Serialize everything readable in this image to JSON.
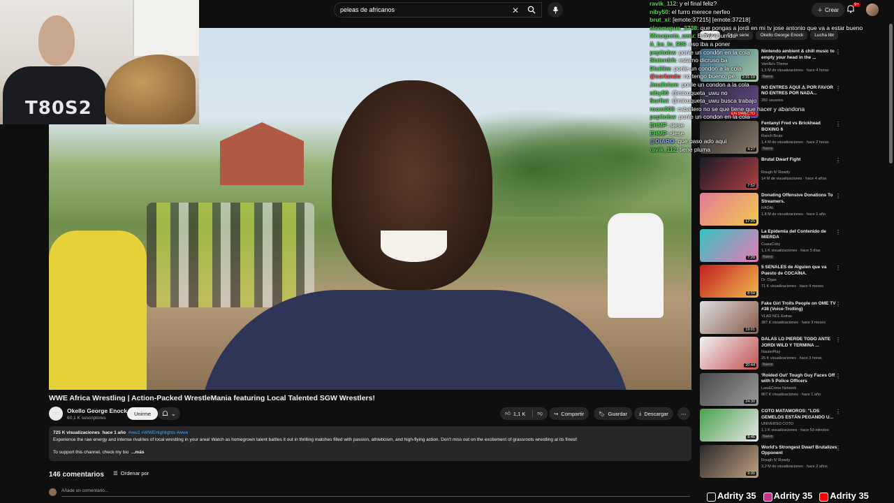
{
  "search": {
    "value": "peleas de africanos"
  },
  "header": {
    "create_label": "Crear",
    "notif_count": "9+"
  },
  "webcam": {
    "shirt_text": "T80S2"
  },
  "chat": [
    {
      "user": "ravik_112",
      "text": "y el final feliz?",
      "color": "green"
    },
    {
      "user": "niby50",
      "text": "el furro merece nerfeo",
      "color": "green"
    },
    {
      "user": "brut_xi",
      "text": "[emote:37215] [emote:37218]",
      "color": "green"
    },
    {
      "user": "elcomepus_3738",
      "text": "que pongas a jordi en mi tv jose antonio que va a estar bueno",
      "color": "green"
    },
    {
      "user": "Mixuqueta_uwu",
      "text": "Estoy aburrida",
      "color": "green"
    },
    {
      "user": "A_be_lo_909",
      "text": "eso iba a poner",
      "color": "green"
    },
    {
      "user": "pepitobw",
      "text": "ponle un condón en la cola",
      "color": "green"
    },
    {
      "user": "Slaterdrh",
      "text": "estamo dicruso ba",
      "color": "green"
    },
    {
      "user": "Dlaiiiim",
      "text": "ponle un condon a la cola",
      "color": "green"
    },
    {
      "user": "@sorlando",
      "text": "no tengo bueno, pe...",
      "color": "red"
    },
    {
      "user": "Jmallelam",
      "text": "ponle un condon a la cola",
      "color": "green"
    },
    {
      "user": "niby50",
      "text": "@mixuqueta_uwu no",
      "color": "green"
    },
    {
      "user": "Surfist",
      "text": "@mixuqueta_uwu busca trabajo",
      "color": "green"
    },
    {
      "user": "room008",
      "text": "caballero no se que tiene que hacer y abandona",
      "color": "green"
    },
    {
      "user": "pepitobw",
      "text": "ponle un condon en la cola",
      "color": "green"
    },
    {
      "user": "EHMP",
      "text": "siese",
      "color": "green"
    },
    {
      "user": "EHMP",
      "text": "siese",
      "color": "green"
    },
    {
      "user": "@DIARO",
      "text": "que paso ado aqui",
      "color": "blue"
    },
    {
      "user": "ravik_112",
      "text": "tiene pluma",
      "color": "green"
    }
  ],
  "video": {
    "title": "WWE Africa Wrestling | Action-Packed WrestleMania featuring Local Talented SGW Wrestlers!",
    "channel": "Okello George Enock",
    "subs": "60,1 K suscriptores",
    "join_label": "Unirme",
    "likes": "1,1 K",
    "share_label": "Compartir",
    "save_label": "Guardar",
    "download_label": "Descargar",
    "views": "725 K visualizaciones",
    "age": "hace 1 año",
    "tags": "#ww2 #WWEHighlights #wwe",
    "description": "Experience the raw energy and intense rivalries of local wrestling in your area! Watch as homegrown talent battles it out in thrilling matches filled with passion, athleticism, and high-flying action. Don't miss out on the excitement of grassroots wrestling at its finest!",
    "support": "To support this channel, check my bio",
    "more": "...más"
  },
  "comments": {
    "count": "146 comentarios",
    "sort_label": "Ordenar por",
    "placeholder": "Añade un comentario..."
  },
  "chips": [
    "Todos",
    "De la serie",
    "Okello George Enock",
    "Lucha libr"
  ],
  "recs": [
    {
      "title": "Nintendo ambient & chill music to empty your head in the ...",
      "channel": "Vanilla's Theme",
      "meta": "1,5 M de visualizaciones · hace 4 horas",
      "badge": "Nuevo",
      "dur": "2:31:19",
      "c1": "#3a6b8e",
      "c2": "#a4c8a0"
    },
    {
      "title": "NO ENTRES AQUÍ ⚠ POR FAVOR NO ENTRES POR NADA...",
      "channel": "",
      "meta": "282 usuarios",
      "badge": "",
      "dur": "EN DIRECTO",
      "c1": "#2a2a3a",
      "c2": "#6a4a8a"
    },
    {
      "title": "Fentanyl Fred vs Brickhead BOXING 6",
      "channel": "Ranch Bruto",
      "meta": "1,4 M de visualizaciones · hace 2 horas",
      "badge": "Nuevo",
      "dur": "4:27",
      "c1": "#2a2a2a",
      "c2": "#8a7a6a"
    },
    {
      "title": "Brutal Dwarf Fight",
      "channel": "Rough N' Rowdy",
      "meta": "14 M de visualizaciones · hace 4 años",
      "badge": "",
      "dur": "7:52",
      "c1": "#1a1a2a",
      "c2": "#b04040"
    },
    {
      "title": "Donating Offensive Donations To Streamers.",
      "channel": "RADAL",
      "meta": "1,8 M de visualizaciones · hace 1 año",
      "badge": "",
      "dur": "17:25",
      "c1": "#e07a9a",
      "c2": "#f2c94c"
    },
    {
      "title": "La Epidemia del Contenido de MIERDA",
      "channel": "CuaiaCoby",
      "meta": "1,1 K visualizaciones · hace 5 días",
      "badge": "Nuevo",
      "dur": "7:20",
      "c1": "#35c2c2",
      "c2": "#e87ab5"
    },
    {
      "title": "5 SEÑALES de Alguien que va Puesto de COCAÍNA.",
      "channel": "Dr. Ogas",
      "meta": "71 K visualizaciones · hace 4 meses",
      "badge": "",
      "dur": "8:59",
      "c1": "#c02020",
      "c2": "#f2b84c"
    },
    {
      "title": "Fake Girl Trolls People on OME TV #38 (Voice-Trolling)",
      "channel": "VLAD NCL Extras",
      "meta": "387 K visualizaciones · hace 3 meses",
      "badge": "",
      "dur": "19:01",
      "c1": "#dcdcdc",
      "c2": "#8a5a4a"
    },
    {
      "title": "DALAS LO PIERDE TODO ANTE JORDI WILD Y TERMINA ...",
      "channel": "NauterPlay",
      "meta": "25 K visualizaciones · hace 3 horas",
      "badge": "Nuevo",
      "dur": "20:44",
      "c1": "#f2f2f2",
      "c2": "#c05050"
    },
    {
      "title": "'Roided Out' Tough Guy Faces Off with 5 Police Officers",
      "channel": "Law&Crime Network",
      "meta": "867 K visualizaciones · hace 1 año",
      "badge": "",
      "dur": "24:30",
      "c1": "#4a4a4a",
      "c2": "#9a9a9a"
    },
    {
      "title": "COTO MATAMOROS: \"LOS GEMELOS ESTÁN PEGANDO U...",
      "channel": "UNIVERSO COTO",
      "meta": "1,1 K visualizaciones · hace 53 minutos",
      "badge": "Nuevo",
      "dur": "8:45",
      "c1": "#4aa04a",
      "c2": "#e8e8e8"
    },
    {
      "title": "World's Strongest Dwarf Brutalizes Opponent",
      "channel": "Rough N' Rowdy",
      "meta": "3,2 M de visualizaciones · hace 2 años",
      "badge": "",
      "dur": "9:00",
      "c1": "#2a2a2a",
      "c2": "#c0a080"
    }
  ],
  "social": [
    "Adrity 35",
    "Adrity 35",
    "Adrity 35"
  ]
}
